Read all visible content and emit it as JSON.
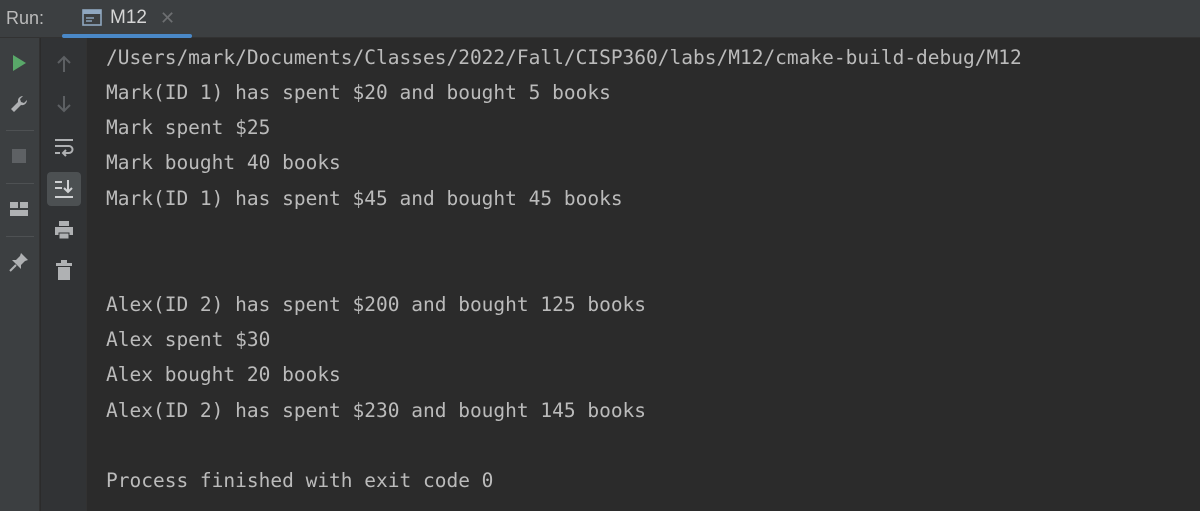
{
  "toolwindow": {
    "run_label": "Run:",
    "tab": {
      "label": "M12",
      "icon": "console-window-icon"
    }
  },
  "sidebar": {
    "buttons": [
      {
        "name": "rerun-icon",
        "tooltip": "Rerun"
      },
      {
        "name": "wrench-icon",
        "tooltip": "Edit Configurations"
      },
      {
        "name": "stop-icon",
        "tooltip": "Stop"
      },
      {
        "name": "layout-icon",
        "tooltip": "Layout"
      },
      {
        "name": "pin-icon",
        "tooltip": "Pin Tab"
      }
    ]
  },
  "console_toolbar": {
    "buttons": [
      {
        "name": "arrow-up-icon"
      },
      {
        "name": "arrow-down-icon"
      },
      {
        "name": "soft-wrap-icon"
      },
      {
        "name": "scroll-to-end-icon"
      },
      {
        "name": "print-icon"
      },
      {
        "name": "trash-icon"
      }
    ]
  },
  "console": {
    "lines": [
      "/Users/mark/Documents/Classes/2022/Fall/CISP360/labs/M12/cmake-build-debug/M12",
      "Mark(ID 1) has spent $20 and bought 5 books",
      "Mark spent $25",
      "Mark bought 40 books",
      "Mark(ID 1) has spent $45 and bought 45 books",
      "",
      "",
      "Alex(ID 2) has spent $200 and bought 125 books",
      "Alex spent $30",
      "Alex bought 20 books",
      "Alex(ID 2) has spent $230 and bought 145 books",
      "",
      "Process finished with exit code 0"
    ]
  }
}
